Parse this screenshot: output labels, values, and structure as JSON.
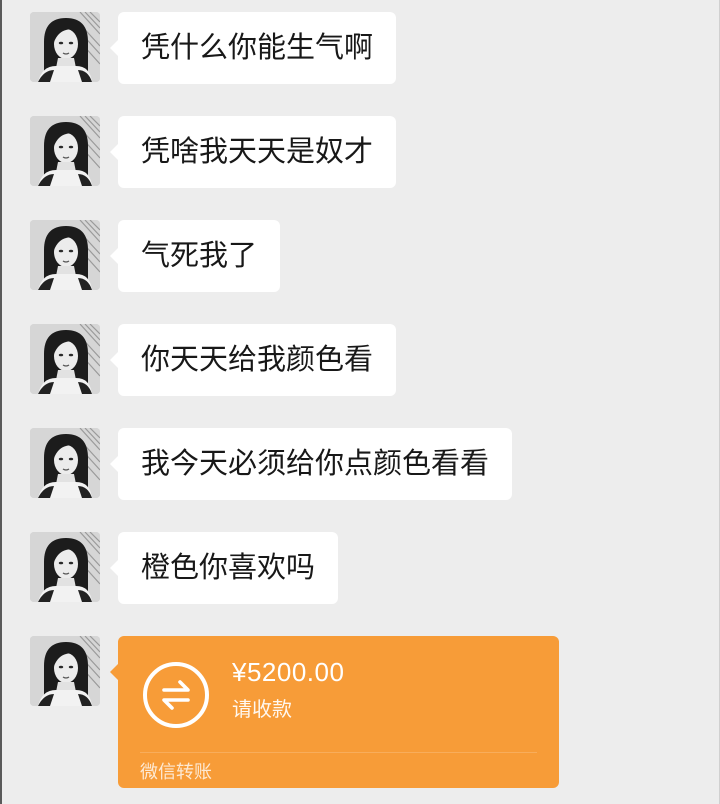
{
  "chat": {
    "background": "#ededed",
    "bubble_color": "#ffffff",
    "avatar_icon": "avatar-photo",
    "messages": [
      {
        "text": "凭什么你能生气啊"
      },
      {
        "text": "凭啥我天天是奴才"
      },
      {
        "text": "气死我了"
      },
      {
        "text": "你天天给我颜色看"
      },
      {
        "text": "我今天必须给你点颜色看看"
      },
      {
        "text": "橙色你喜欢吗"
      }
    ],
    "transfer": {
      "amount": "¥5200.00",
      "status": "请收款",
      "label": "微信转账",
      "color": "#f79c38",
      "icon": "transfer-arrows-icon"
    }
  }
}
